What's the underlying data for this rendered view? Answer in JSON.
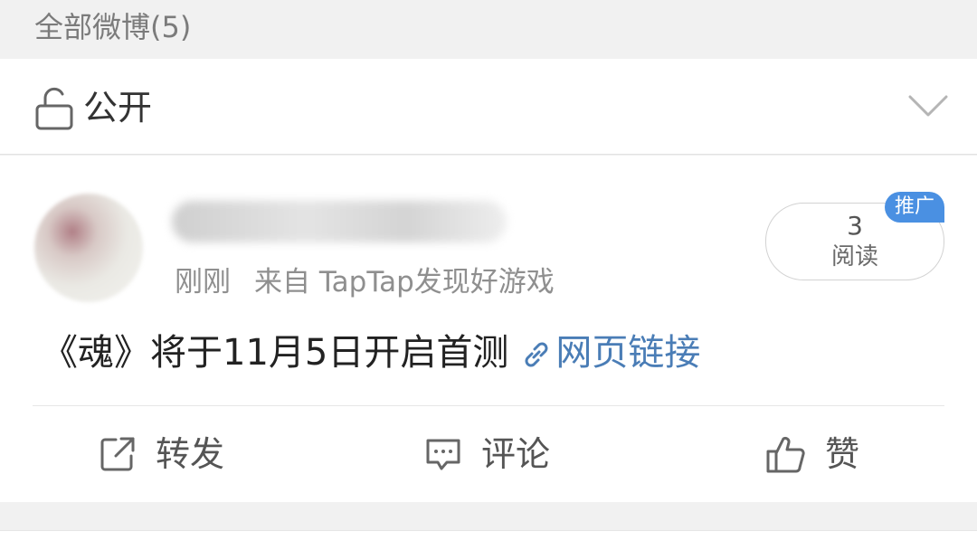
{
  "header": {
    "title": "全部微博(5)"
  },
  "visibility": {
    "icon": "unlock-icon",
    "label": "公开",
    "dropdown_icon": "chevron-down-icon"
  },
  "post": {
    "time": "刚刚",
    "source": "来自 TapTap发现好游戏",
    "read_count": "3",
    "read_label": "阅读",
    "badge": "推广",
    "text": "《魂》将于11月5日开启首测",
    "link_text": "网页链接"
  },
  "actions": {
    "repost": "转发",
    "comment": "评论",
    "like": "赞"
  },
  "colors": {
    "link": "#4a7db6",
    "badge": "#4a90e2",
    "background": "#f1f1f1"
  }
}
